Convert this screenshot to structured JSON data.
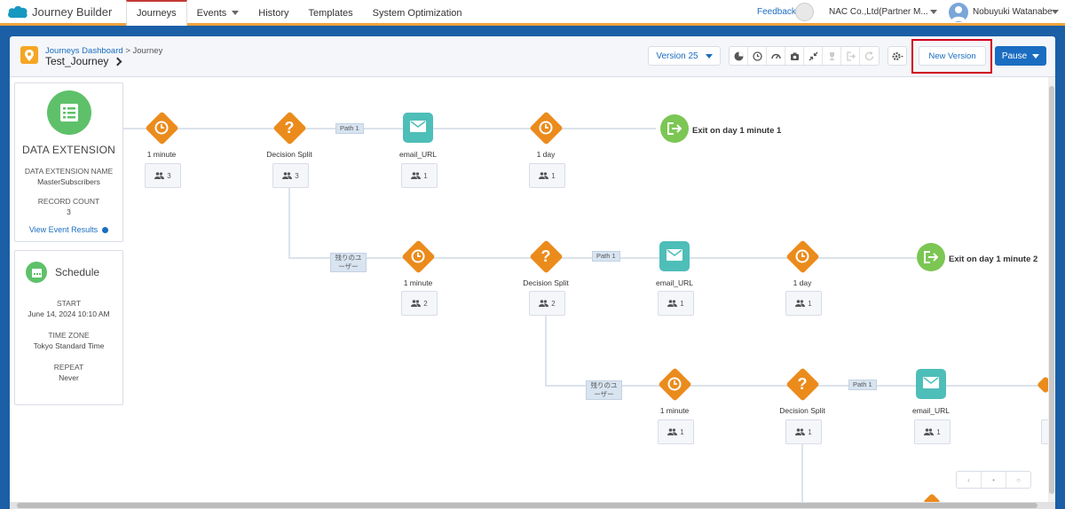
{
  "app": {
    "title": "Journey Builder"
  },
  "nav": {
    "tabs": [
      {
        "label": "Journeys"
      },
      {
        "label": "Events"
      },
      {
        "label": "History"
      },
      {
        "label": "Templates"
      },
      {
        "label": "System Optimization"
      }
    ],
    "feedback": "Feedback",
    "org": "NAC Co.,Ltd(Partner M...",
    "user": "Nobuyuki Watanabe"
  },
  "header": {
    "breadcrumb_link": "Journeys Dashboard",
    "breadcrumb_sep": ">",
    "breadcrumb_current": "Journey",
    "journey_name": "Test_Journey",
    "version": "Version 25",
    "new_version": "New Version",
    "pause": "Pause"
  },
  "entry": {
    "title": "DATA EXTENSION",
    "name_label": "DATA EXTENSION NAME",
    "name_value": "MasterSubscribers",
    "count_label": "RECORD COUNT",
    "count_value": "3",
    "link": "View Event Results"
  },
  "schedule": {
    "title": "Schedule",
    "start_label": "START",
    "start_value": "June 14, 2024 10:10 AM",
    "tz_label": "TIME ZONE",
    "tz_value": "Tokyo Standard Time",
    "repeat_label": "REPEAT",
    "repeat_value": "Never"
  },
  "rows": [
    {
      "nodes": [
        {
          "label": "1 minute",
          "count": "3"
        },
        {
          "label": "Decision Split",
          "count": "3"
        },
        {
          "label": "email_URL",
          "count": "1"
        },
        {
          "label": "1 day",
          "count": "1"
        }
      ],
      "path_tag": "Path 1",
      "exit": "Exit on day 1 minute 1"
    },
    {
      "branch_tag": "残りのユーザー",
      "nodes": [
        {
          "label": "1 minute",
          "count": "2"
        },
        {
          "label": "Decision Split",
          "count": "2"
        },
        {
          "label": "email_URL",
          "count": "1"
        },
        {
          "label": "1 day",
          "count": "1"
        }
      ],
      "path_tag": "Path 1",
      "exit": "Exit on day 1 minute 2"
    },
    {
      "branch_tag": "残りのユーザー",
      "nodes": [
        {
          "label": "1 minute",
          "count": "1"
        },
        {
          "label": "Decision Split",
          "count": "1"
        },
        {
          "label": "email_URL",
          "count": "1"
        }
      ],
      "path_tag": "Path 1"
    }
  ]
}
